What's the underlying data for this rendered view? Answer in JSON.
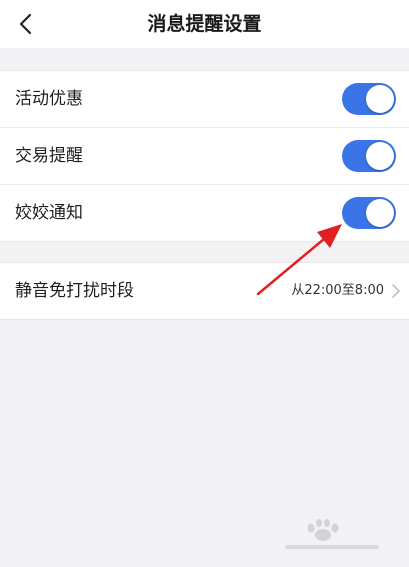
{
  "header": {
    "title": "消息提醒设置",
    "back_icon": "chevron-left-icon"
  },
  "notifications": [
    {
      "label": "活动优惠",
      "enabled": true
    },
    {
      "label": "交易提醒",
      "enabled": true
    },
    {
      "label": "姣姣通知",
      "enabled": true
    }
  ],
  "quiet_hours": {
    "label": "静音免打扰时段",
    "value": "从22:00至8:00",
    "icon": "chevron-right-icon"
  },
  "colors": {
    "toggle_on": "#3a74e6",
    "annotation_arrow": "#e02020",
    "background": "#f2f2f4"
  }
}
